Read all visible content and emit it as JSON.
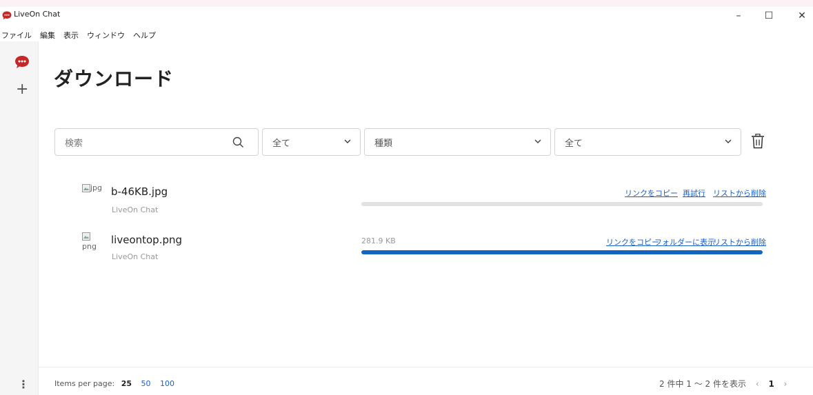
{
  "window": {
    "title": "LiveOn Chat",
    "minimize_label": "–",
    "maximize_label": "☐",
    "close_label": "✕"
  },
  "menu": [
    "ファイル",
    "編集",
    "表示",
    "ウィンドウ",
    "ヘルプ"
  ],
  "page": {
    "title": "ダウンロード"
  },
  "filters": {
    "search_placeholder": "検索",
    "status_value": "全て",
    "type_value": "種類",
    "source_value": "全て"
  },
  "downloads": [
    {
      "thumb_alt": "jpg",
      "name": "b-46KB.jpg",
      "source": "LiveOn Chat",
      "size": "",
      "progress": 0,
      "actions": [
        "リンクをコピー",
        "再試行",
        "リストから削除"
      ]
    },
    {
      "thumb_alt": "png",
      "name": "liveontop.png",
      "source": "LiveOn Chat",
      "size": "281.9 KB",
      "progress": 1.0,
      "actions": [
        "リンクをコピー",
        "フォルダーに表示",
        "リストから削除"
      ]
    }
  ],
  "footer": {
    "items_per_page_label": "Items per page:",
    "ipp_current": "25",
    "ipp_options": [
      "50",
      "100"
    ],
    "range_text": "2 件中 1 ～ 2 件を表示",
    "prev_label": "‹",
    "current_page": "1",
    "next_label": "›"
  },
  "colors": {
    "accent": "#1565c0",
    "link": "#1a5fc7",
    "brand": "#c62828"
  },
  "icons": [
    "liveon-chat-icon",
    "plus-icon",
    "more-vertical-icon",
    "search-icon",
    "chevron-down-icon",
    "trash-icon"
  ]
}
